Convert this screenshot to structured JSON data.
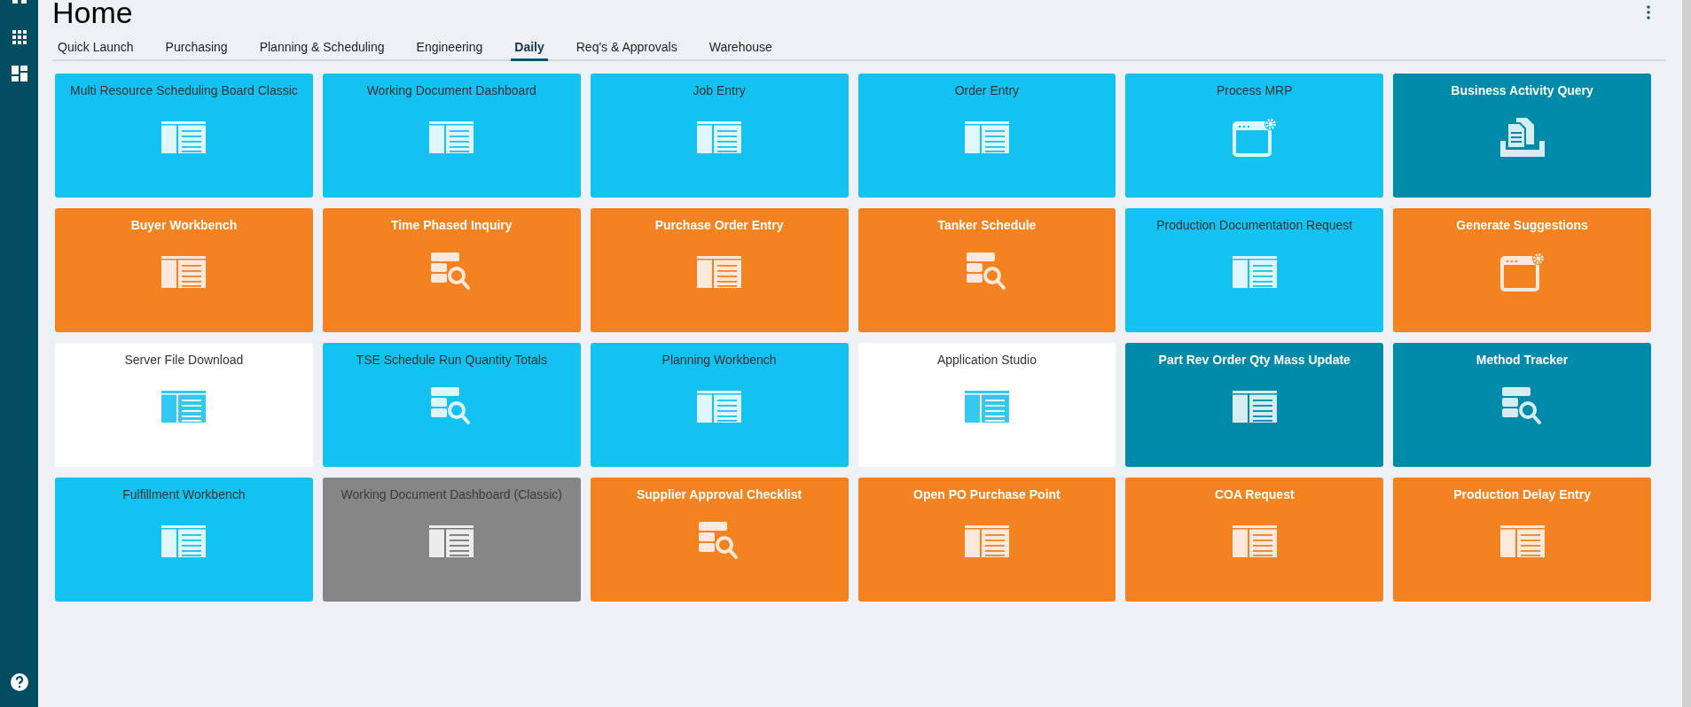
{
  "page": {
    "title": "Home"
  },
  "tabs": [
    {
      "label": "Quick Launch",
      "selected": false
    },
    {
      "label": "Purchasing",
      "selected": false
    },
    {
      "label": "Planning & Scheduling",
      "selected": false
    },
    {
      "label": "Engineering",
      "selected": false
    },
    {
      "label": "Daily",
      "selected": true
    },
    {
      "label": "Req's & Approvals",
      "selected": false
    },
    {
      "label": "Warehouse",
      "selected": false
    }
  ],
  "tiles": [
    {
      "title": "Multi Resource Scheduling Board Classic",
      "kind": "light"
    },
    {
      "title": "Working Document Dashboard",
      "kind": "light"
    },
    {
      "title": "Job Entry",
      "kind": "light"
    },
    {
      "title": "Order Entry",
      "kind": "light"
    },
    {
      "title": "Process MRP",
      "kind": "light"
    },
    {
      "title": "Business Activity Query",
      "kind": "dark"
    },
    {
      "title": "Buyer Workbench",
      "kind": "orange"
    },
    {
      "title": "Time Phased Inquiry",
      "kind": "orange"
    },
    {
      "title": "Purchase Order Entry",
      "kind": "orange"
    },
    {
      "title": "Tanker Schedule",
      "kind": "orange"
    },
    {
      "title": "Production Documentation Request",
      "kind": "light"
    },
    {
      "title": "Generate Suggestions",
      "kind": "orange"
    },
    {
      "title": "Server File Download",
      "kind": "white"
    },
    {
      "title": "TSE Schedule Run Quantity Totals",
      "kind": "light"
    },
    {
      "title": "Planning Workbench",
      "kind": "light"
    },
    {
      "title": "Application Studio",
      "kind": "white"
    },
    {
      "title": "Part Rev Order Qty Mass Update",
      "kind": "dark"
    },
    {
      "title": "Method Tracker",
      "kind": "dark"
    },
    {
      "title": "Fulfillment Workbench",
      "kind": "light"
    },
    {
      "title": "Working Document Dashboard (Classic)",
      "kind": "gray"
    },
    {
      "title": "Supplier Approval Checklist",
      "kind": "orange"
    },
    {
      "title": "Open PO Purchase Point",
      "kind": "orange"
    },
    {
      "title": "COA Request",
      "kind": "orange"
    },
    {
      "title": "Production Delay Entry",
      "kind": "orange"
    }
  ]
}
